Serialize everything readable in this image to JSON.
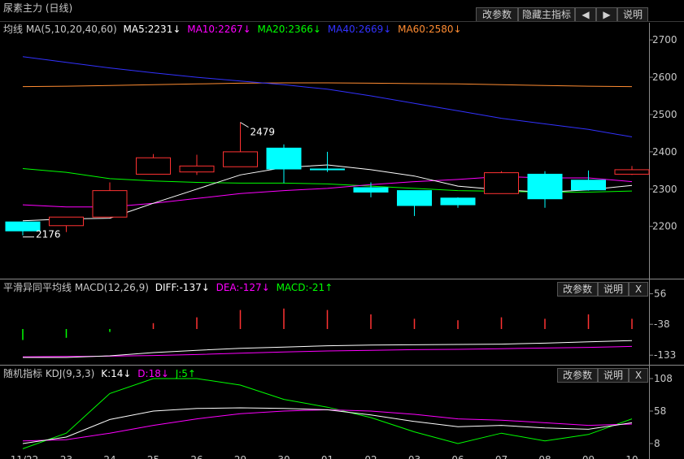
{
  "title": "尿素主力 (日线)",
  "toolbar": {
    "params": "改参数",
    "hide_main": "隐藏主指标",
    "left_arrow": "◀",
    "right_arrow": "▶",
    "help": "说明"
  },
  "colors": {
    "up": "#ff3232",
    "down": "#00ffff",
    "ma5": "#ffffff",
    "ma10": "#ff00ff",
    "ma20": "#00ff00",
    "ma40": "#3232ff",
    "ma60": "#ff8c32"
  },
  "main": {
    "label": "均线 MA(5,10,20,40,60)",
    "legend": [
      {
        "text": "MA5:2231↓",
        "color": "#ffffff"
      },
      {
        "text": "MA10:2267↓",
        "color": "#ff00ff"
      },
      {
        "text": "MA20:2366↓",
        "color": "#00ff00"
      },
      {
        "text": "MA40:2669↓",
        "color": "#3232ff"
      },
      {
        "text": "MA60:2580↓",
        "color": "#ff8c32"
      }
    ],
    "yticks": [
      "2700",
      "2600",
      "2500",
      "2400",
      "2300",
      "2200"
    ],
    "annotations": [
      "2479",
      "2176"
    ]
  },
  "macd": {
    "label": "平滑异同平均线 MACD(12,26,9)",
    "legend": [
      {
        "text": "DIFF:-137↓",
        "color": "#ffffff"
      },
      {
        "text": "DEA:-127↓",
        "color": "#ff00ff"
      },
      {
        "text": "MACD:-21↑",
        "color": "#00ff00"
      }
    ],
    "yticks": [
      "56",
      "-38",
      "-133"
    ],
    "buttons": {
      "params": "改参数",
      "help": "说明",
      "close": "X"
    }
  },
  "kdj": {
    "label": "随机指标 KDJ(9,3,3)",
    "legend": [
      {
        "text": "K:14↓",
        "color": "#ffffff"
      },
      {
        "text": "D:18↓",
        "color": "#ff00ff"
      },
      {
        "text": "J:5↑",
        "color": "#00ff00"
      }
    ],
    "yticks": [
      "108",
      "58",
      "8"
    ],
    "buttons": {
      "params": "改参数",
      "help": "说明",
      "close": "X"
    }
  },
  "xlabels": [
    "11/22",
    "23",
    "24",
    "25",
    "26",
    "29",
    "30",
    "01",
    "02",
    "03",
    "06",
    "07",
    "08",
    "09",
    "10"
  ],
  "chart_data": {
    "type": "candlestick",
    "dates": [
      "11/22",
      "23",
      "24",
      "25",
      "26",
      "29",
      "30",
      "01",
      "02",
      "03",
      "06",
      "07",
      "08",
      "09",
      "10"
    ],
    "ohlc": [
      [
        2212,
        2212,
        2176,
        2188
      ],
      [
        2202,
        2222,
        2185,
        2225
      ],
      [
        2225,
        2318,
        2240,
        2296
      ],
      [
        2340,
        2394,
        2340,
        2384
      ],
      [
        2346,
        2392,
        2338,
        2362
      ],
      [
        2360,
        2479,
        2360,
        2400
      ],
      [
        2410,
        2420,
        2316,
        2354
      ],
      [
        2354,
        2400,
        2346,
        2354
      ],
      [
        2304,
        2318,
        2278,
        2292
      ],
      [
        2296,
        2296,
        2228,
        2256
      ],
      [
        2276,
        2278,
        2250,
        2258
      ],
      [
        2288,
        2348,
        2288,
        2344
      ],
      [
        2340,
        2348,
        2250,
        2274
      ],
      [
        2324,
        2350,
        2296,
        2298
      ],
      [
        2340,
        2362,
        2338,
        2352
      ]
    ],
    "ma5": [
      2215,
      2220,
      2222,
      2262,
      2300,
      2338,
      2358,
      2365,
      2352,
      2335,
      2308,
      2298,
      2292,
      2298,
      2310
    ],
    "ma10": [
      2258,
      2252,
      2252,
      2262,
      2275,
      2288,
      2296,
      2302,
      2312,
      2320,
      2326,
      2334,
      2330,
      2330,
      2320
    ],
    "ma20": [
      2355,
      2345,
      2328,
      2322,
      2318,
      2316,
      2316,
      2314,
      2308,
      2302,
      2296,
      2294,
      2292,
      2292,
      2295
    ],
    "ma40": [
      2655,
      2640,
      2625,
      2612,
      2600,
      2590,
      2580,
      2568,
      2550,
      2530,
      2510,
      2490,
      2475,
      2460,
      2440
    ],
    "ma60": [
      2575,
      2576,
      2578,
      2580,
      2582,
      2584,
      2585,
      2585,
      2584,
      2583,
      2582,
      2580,
      2578,
      2576,
      2575
    ],
    "ylim": [
      2110,
      2720
    ],
    "macd": {
      "ylim": [
        -140,
        60
      ],
      "hist": [
        -15,
        -12,
        -4,
        8,
        16,
        26,
        28,
        26,
        20,
        14,
        12,
        16,
        14,
        20,
        14
      ],
      "diff": [
        -140,
        -140,
        -135,
        -125,
        -118,
        -112,
        -108,
        -104,
        -102,
        -101,
        -100,
        -99,
        -96,
        -92,
        -88
      ],
      "dea": [
        -138,
        -137,
        -136,
        -134,
        -131,
        -127,
        -123,
        -120,
        -118,
        -116,
        -115,
        -113,
        -111,
        -109,
        -106
      ]
    },
    "kdj": {
      "ylim": [
        0,
        115
      ],
      "k": [
        8,
        18,
        45,
        58,
        62,
        63,
        62,
        60,
        52,
        42,
        34,
        36,
        32,
        30,
        40
      ],
      "d": [
        12,
        14,
        24,
        36,
        46,
        54,
        58,
        60,
        58,
        53,
        46,
        44,
        40,
        36,
        38
      ],
      "j": [
        0,
        24,
        85,
        108,
        108,
        98,
        76,
        64,
        48,
        26,
        8,
        24,
        12,
        22,
        46
      ]
    }
  }
}
